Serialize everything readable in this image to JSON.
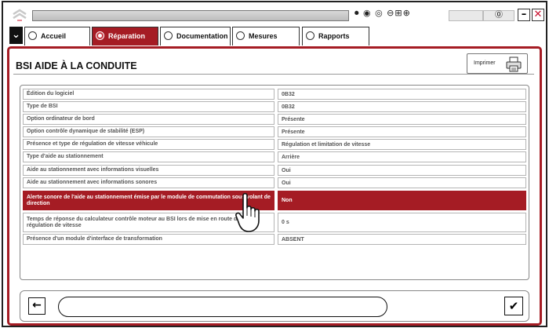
{
  "topbar": {
    "title_value": "",
    "status_icons": "⏺ ◉ ◎ ⊖⊞⊕",
    "field3_text": "⓪",
    "minimize_label": "–",
    "close_label": "✕"
  },
  "tabs": [
    {
      "label": "Accueil",
      "active": false
    },
    {
      "label": "Réparation",
      "active": true
    },
    {
      "label": "Documentation",
      "active": false
    },
    {
      "label": "Mesures",
      "active": false
    },
    {
      "label": "Rapports",
      "active": false
    }
  ],
  "page": {
    "title": "BSI  AIDE À LA CONDUITE",
    "print_label": "Imprimer"
  },
  "table": {
    "rows": [
      {
        "label": "Édition du logiciel",
        "value": "0B32"
      },
      {
        "label": "Type de BSI",
        "value": "0B32"
      },
      {
        "label": "Option ordinateur de bord",
        "value": "Présente"
      },
      {
        "label": "Option contrôle dynamique de stabilité (ESP)",
        "value": "Présente"
      },
      {
        "label": "Présence et type de régulation de vitesse véhicule",
        "value": "Régulation et limitation de vitesse"
      },
      {
        "label": "Type d'aide au stationnement",
        "value": "Arrière"
      },
      {
        "label": "Aide au stationnement avec informations visuelles",
        "value": "Oui"
      },
      {
        "label": "Aide au stationnement avec informations sonores",
        "value": "Oui"
      },
      {
        "label": "Alerte sonore de l'aide au stationnement émise par le module de commutation sous volant de direction",
        "value": "Non",
        "selected": true
      },
      {
        "label": "Temps de réponse du calculateur contrôle moteur au BSI lors de mise en route de la régulation de vitesse",
        "value": "0 s"
      },
      {
        "label": "Présence d'un module d'interface de transformation",
        "value": "ABSENT"
      }
    ]
  },
  "bottom": {
    "back_label": "←",
    "ok_label": "✔",
    "message": ""
  },
  "colors": {
    "accent": "#a51c24"
  }
}
